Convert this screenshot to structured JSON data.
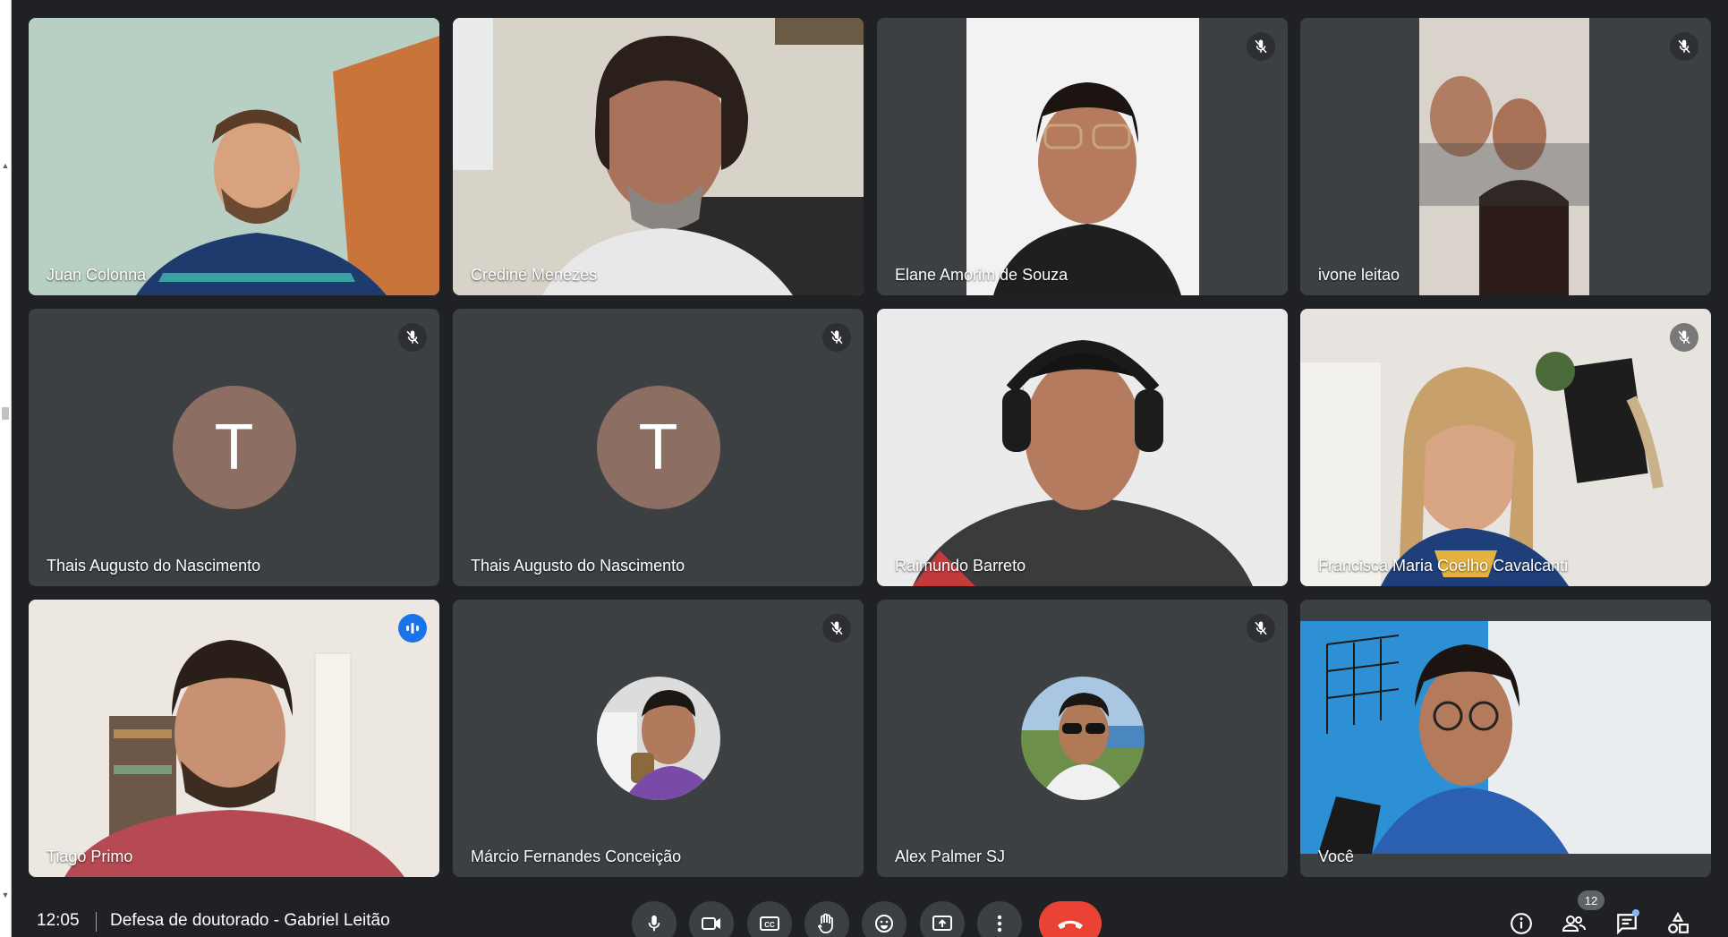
{
  "meeting": {
    "time": "12:05",
    "title": "Defesa de doutorado - Gabriel Leitão"
  },
  "participants": [
    {
      "name": "Juan Colonna",
      "muted": false
    },
    {
      "name": "Crediné Menezes",
      "muted": false
    },
    {
      "name": "Elane Amorim de Souza",
      "muted": true
    },
    {
      "name": "ivone leitao",
      "muted": true
    },
    {
      "name": "Thais Augusto do Nascimento",
      "muted": true,
      "avatar_letter": "T"
    },
    {
      "name": "Thais Augusto do Nascimento",
      "muted": true,
      "avatar_letter": "T"
    },
    {
      "name": "Raimundo Barreto",
      "muted": false
    },
    {
      "name": "Francisca Maria Coelho Cavalcanti",
      "muted": true
    },
    {
      "name": "Tiago Primo",
      "muted": false,
      "speaking": true
    },
    {
      "name": "Márcio Fernandes Conceição",
      "muted": true
    },
    {
      "name": "Alex Palmer SJ",
      "muted": true
    },
    {
      "name": "Você",
      "muted": false
    }
  ],
  "controls": {
    "participant_count": "12",
    "icons": [
      "mic-icon",
      "camera-icon",
      "captions-icon",
      "raise-hand-icon",
      "emoji-icon",
      "present-icon",
      "more-options-icon",
      "end-call-icon"
    ],
    "right_icons": [
      "info-icon",
      "people-icon",
      "chat-icon",
      "activities-icon"
    ]
  },
  "colors": {
    "background": "#202124",
    "tile": "#3c4043",
    "speaking_outline": "#8ab4f8",
    "end_call": "#ea4335",
    "avatar": "#8d6e63"
  }
}
